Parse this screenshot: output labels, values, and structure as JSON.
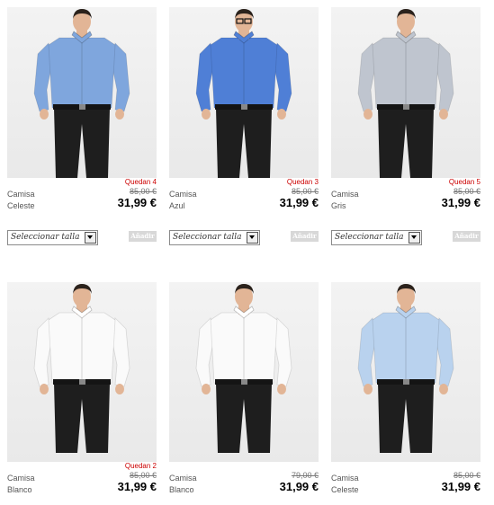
{
  "products": [
    {
      "name_line1": "Camisa",
      "name_line2": "Celeste",
      "stock": "Quedan 4",
      "old_price": "85,00 €",
      "price": "31,99 €",
      "size_placeholder": "Seleccionar talla",
      "add_label": "Añadir",
      "shirt_color": "#7fa6dd",
      "has_glasses": false
    },
    {
      "name_line1": "Camisa",
      "name_line2": "Azul",
      "stock": "Quedan 3",
      "old_price": "85,00 €",
      "price": "31,99 €",
      "size_placeholder": "Seleccionar talla",
      "add_label": "Añadir",
      "shirt_color": "#4f7fd6",
      "has_glasses": true
    },
    {
      "name_line1": "Camisa",
      "name_line2": "Gris",
      "stock": "Quedan 5",
      "old_price": "85,00 €",
      "price": "31,99 €",
      "size_placeholder": "Seleccionar talla",
      "add_label": "Añadir",
      "shirt_color": "#bfc5cf",
      "has_glasses": false
    },
    {
      "name_line1": "Camisa",
      "name_line2": "Blanco",
      "stock": "Quedan 2",
      "old_price": "85,00 €",
      "price": "31,99 €",
      "shirt_color": "#fafafa",
      "has_glasses": false
    },
    {
      "name_line1": "Camisa",
      "name_line2": "Blanco",
      "stock": "",
      "old_price": "79,00 €",
      "price": "31,99 €",
      "shirt_color": "#fafafa",
      "has_glasses": false
    },
    {
      "name_line1": "Camisa",
      "name_line2": "Celeste",
      "stock": "",
      "old_price": "85,00 €",
      "price": "31,99 €",
      "shirt_color": "#b9d2ee",
      "has_glasses": false
    }
  ],
  "colors": {
    "stock_text": "#cc0000",
    "add_button_bg": "#d8d8d8",
    "photo_bg": "#eeeeee",
    "pants": "#1e1e1e",
    "skin": "#e2b596",
    "hair": "#2b221c"
  }
}
